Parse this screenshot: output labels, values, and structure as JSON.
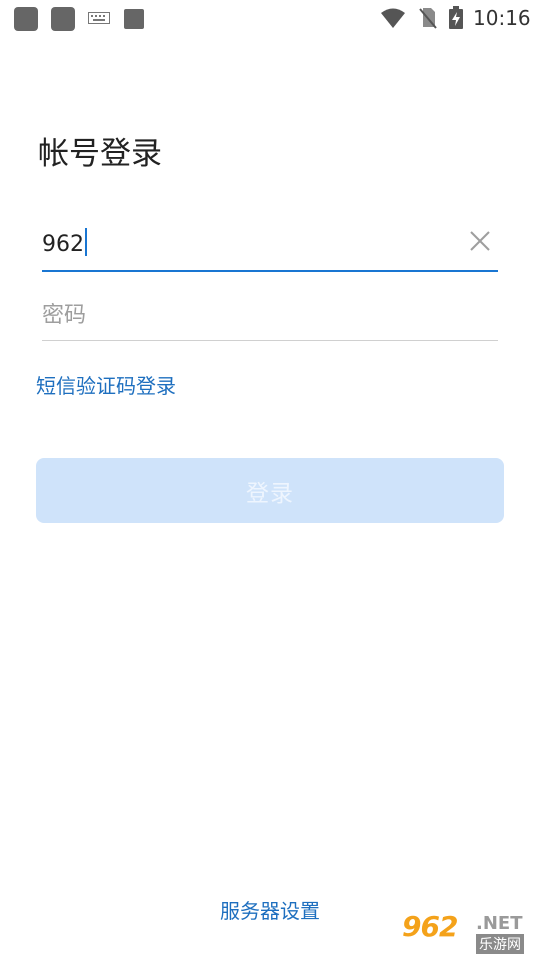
{
  "status_bar": {
    "time": "10:16",
    "icons": [
      "app-icon",
      "app-icon",
      "keyboard-icon",
      "app-icon",
      "wifi-icon",
      "no-sim-icon",
      "battery-charging-icon"
    ]
  },
  "page": {
    "title": "帐号登录"
  },
  "account_field": {
    "value": "962",
    "clear_icon": "close-icon"
  },
  "password_field": {
    "placeholder": "密码",
    "value": ""
  },
  "sms_login_link": "短信验证码登录",
  "login_button": {
    "label": "登录",
    "color": "#cfe3fa",
    "enabled": false
  },
  "server_settings_link": "服务器设置",
  "watermark": {
    "top": "962",
    "net": ".NET",
    "bottom": "乐游网"
  },
  "colors": {
    "accent": "#1976d2",
    "link": "#1e6fbf"
  }
}
